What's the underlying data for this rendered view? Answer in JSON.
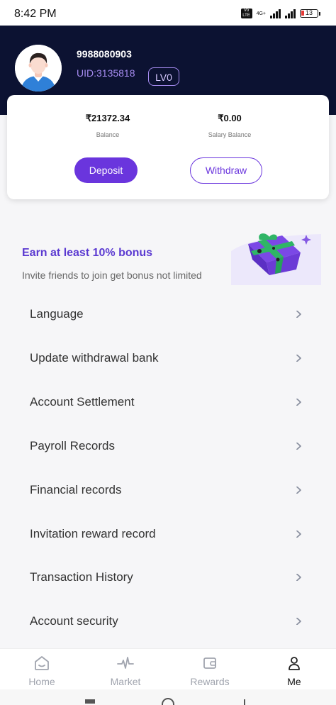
{
  "status_bar": {
    "time": "8:42 PM",
    "volte_label": "Vo LTE",
    "network_label": "4G+",
    "battery_level": "13"
  },
  "profile": {
    "phone": "9988080903",
    "uid": "UID:3135818",
    "level": "LV0"
  },
  "balance": {
    "amount": "₹21372.34",
    "amount_label": "Balance",
    "salary_amount": "₹0.00",
    "salary_label": "Salary Balance",
    "deposit_label": "Deposit",
    "withdraw_label": "Withdraw"
  },
  "promo": {
    "title": "Earn at least 10% bonus",
    "subtitle": "Invite friends to join get bonus not limited",
    "image_icon": "gift-box-icon"
  },
  "menu": [
    {
      "label": "Language"
    },
    {
      "label": "Update withdrawal bank"
    },
    {
      "label": "Account Settlement"
    },
    {
      "label": "Payroll Records"
    },
    {
      "label": "Financial records"
    },
    {
      "label": "Invitation reward record"
    },
    {
      "label": "Transaction History"
    },
    {
      "label": "Account security"
    }
  ],
  "bottom_nav": [
    {
      "label": "Home",
      "icon": "home-icon",
      "active": false
    },
    {
      "label": "Market",
      "icon": "pulse-icon",
      "active": false
    },
    {
      "label": "Rewards",
      "icon": "wallet-icon",
      "active": false
    },
    {
      "label": "Me",
      "icon": "person-icon",
      "active": true
    }
  ],
  "colors": {
    "header_bg": "#0c1232",
    "accent": "#6a35dd",
    "uid_text": "#a58bf0",
    "promo_title": "#5b3ad1"
  }
}
